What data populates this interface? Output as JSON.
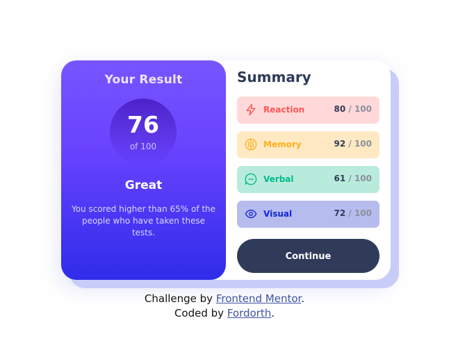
{
  "result": {
    "title": "Your Result",
    "score": "76",
    "score_of": "of 100",
    "rating": "Great",
    "description": "You scored higher than 65% of the people who have taken these tests."
  },
  "summary": {
    "title": "Summary",
    "items": [
      {
        "label": "Reaction",
        "score": "80",
        "max": " / 100",
        "icon": "lightning-icon",
        "bg": "#ffd9d9",
        "color": "#ff5757"
      },
      {
        "label": "Memory",
        "score": "92",
        "max": " / 100",
        "icon": "brain-icon",
        "bg": "#ffe9c2",
        "color": "#ffb01f"
      },
      {
        "label": "Verbal",
        "score": "61",
        "max": " / 100",
        "icon": "chat-bubble-icon",
        "bg": "#b8ebdb",
        "color": "#00bb8f"
      },
      {
        "label": "Visual",
        "score": "72",
        "max": " / 100",
        "icon": "eye-icon",
        "bg": "#b7bcef",
        "color": "#1125d4"
      }
    ],
    "button_label": "Continue"
  },
  "attribution": {
    "line1_prefix": "Challenge by ",
    "line1_link": "Frontend Mentor",
    "line1_suffix": ".",
    "line2_prefix": "Coded by ",
    "line2_link": "Fordorth",
    "line2_suffix": "."
  }
}
